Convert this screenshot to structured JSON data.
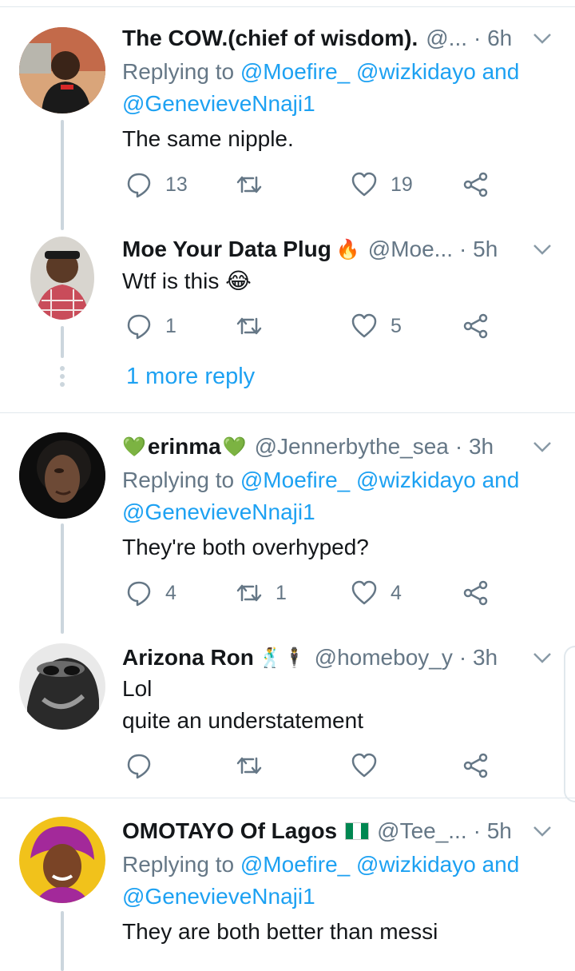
{
  "tweets": [
    {
      "name": "The COW.(chief of wisdom).",
      "handle": "@...",
      "time": "· 6h",
      "replying_prefix": "Replying to",
      "mentions": "@Moefire_ @wizkidayo",
      "and": "and",
      "mention2": "@GenevieveNnaji1",
      "text": "The same nipple.",
      "replies": "13",
      "retweets": "",
      "likes": "19"
    },
    {
      "name": "Moe Your Data Plug",
      "name_emoji": "🔥",
      "handle": "@Moe...",
      "time": "· 5h",
      "text": "Wtf is this 😂",
      "replies": "1",
      "retweets": "",
      "likes": "5"
    },
    {
      "name_prefix_emoji": "💚",
      "name": "erinma",
      "name_emoji": "💚",
      "handle": "@Jennerbythe_sea",
      "time": "· 3h",
      "replying_prefix": "Replying to",
      "mentions": "@Moefire_ @wizkidayo",
      "and": "and",
      "mention2": "@GenevieveNnaji1",
      "text": "They're both overhyped?",
      "replies": "4",
      "retweets": "1",
      "likes": "4"
    },
    {
      "name": "Arizona Ron",
      "name_emoji": "🕺🕴",
      "handle": "@homeboy_y",
      "time": "· 3h",
      "text_line1": "Lol",
      "text_line2": "quite an understatement",
      "replies": "",
      "retweets": "",
      "likes": ""
    },
    {
      "name": "OMOTAYO Of Lagos",
      "handle": "@Tee_...",
      "time": "· 5h",
      "replying_prefix": "Replying to",
      "mentions": "@Moefire_ @wizkidayo",
      "and": "and",
      "mention2": "@GenevieveNnaji1",
      "text": "They are both better than messi"
    }
  ],
  "more_reply": "1 more reply",
  "colors": {
    "accent": "#1da1f2",
    "secondary_text": "#657786",
    "divider": "#e1e8ed",
    "thread_line": "#ccd6dd",
    "nigeria_green": "#008751"
  },
  "icons": [
    "reply-icon",
    "retweet-icon",
    "like-icon",
    "share-icon",
    "chevron-down-icon",
    "nigeria-flag-icon"
  ]
}
